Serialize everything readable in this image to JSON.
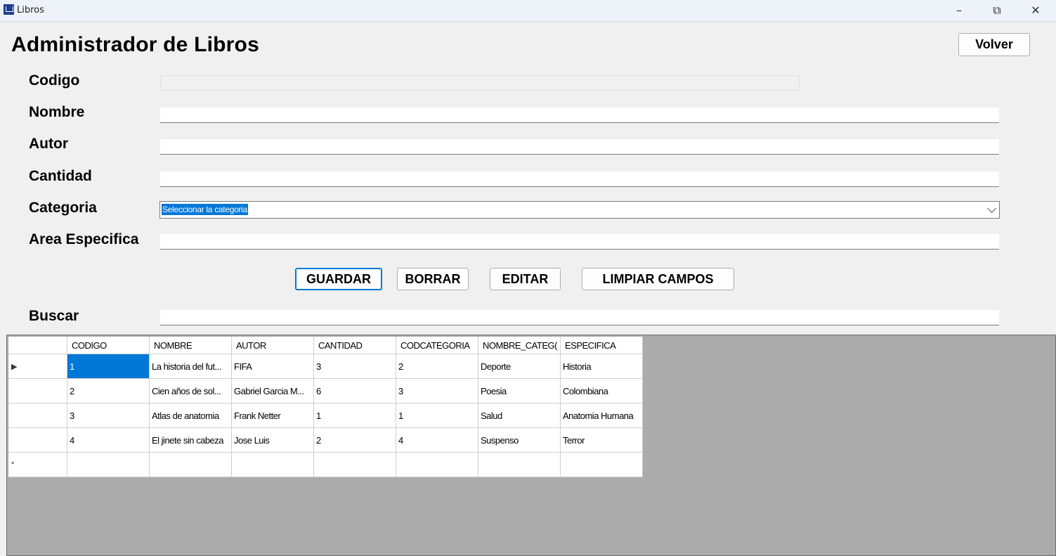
{
  "window": {
    "title": "Libros",
    "minimize": "–",
    "restore": "⧉",
    "close": "✕"
  },
  "header": {
    "title": "Administrador de Libros",
    "back_label": "Volver"
  },
  "form": {
    "codigo_label": "Codigo",
    "nombre_label": "Nombre",
    "autor_label": "Autor",
    "cantidad_label": "Cantidad",
    "categoria_label": "Categoria",
    "categoria_selected": "Seleccionar la categoria",
    "area_label": "Area Especifica",
    "codigo_value": "",
    "nombre_value": "",
    "autor_value": "",
    "cantidad_value": "",
    "area_value": ""
  },
  "actions": {
    "guardar": "GUARDAR",
    "borrar": "BORRAR",
    "editar": "EDITAR",
    "limpiar": "LIMPIAR CAMPOS"
  },
  "search": {
    "label": "Buscar",
    "value": ""
  },
  "grid": {
    "columns": [
      "CODIGO",
      "NOMBRE",
      "AUTOR",
      "CANTIDAD",
      "CODCATEGORIA",
      "NOMBRE_CATEG(",
      "ESPECIFICA"
    ],
    "rows": [
      [
        "1",
        "La historia del fut...",
        "FIFA",
        "3",
        "2",
        "Deporte",
        "Historia"
      ],
      [
        "2",
        "Cien años de sol...",
        "Gabriel Garcia M...",
        "6",
        "3",
        "Poesia",
        "Colombiana"
      ],
      [
        "3",
        "Atlas de anatomia",
        "Frank Netter",
        "1",
        "1",
        "Salud",
        "Anatomia Humana"
      ],
      [
        "4",
        "El jinete sin cabeza",
        "Jose Luis",
        "2",
        "4",
        "Suspenso",
        "Terror"
      ]
    ],
    "current_row_marker": "▶",
    "new_row_marker": "*"
  }
}
